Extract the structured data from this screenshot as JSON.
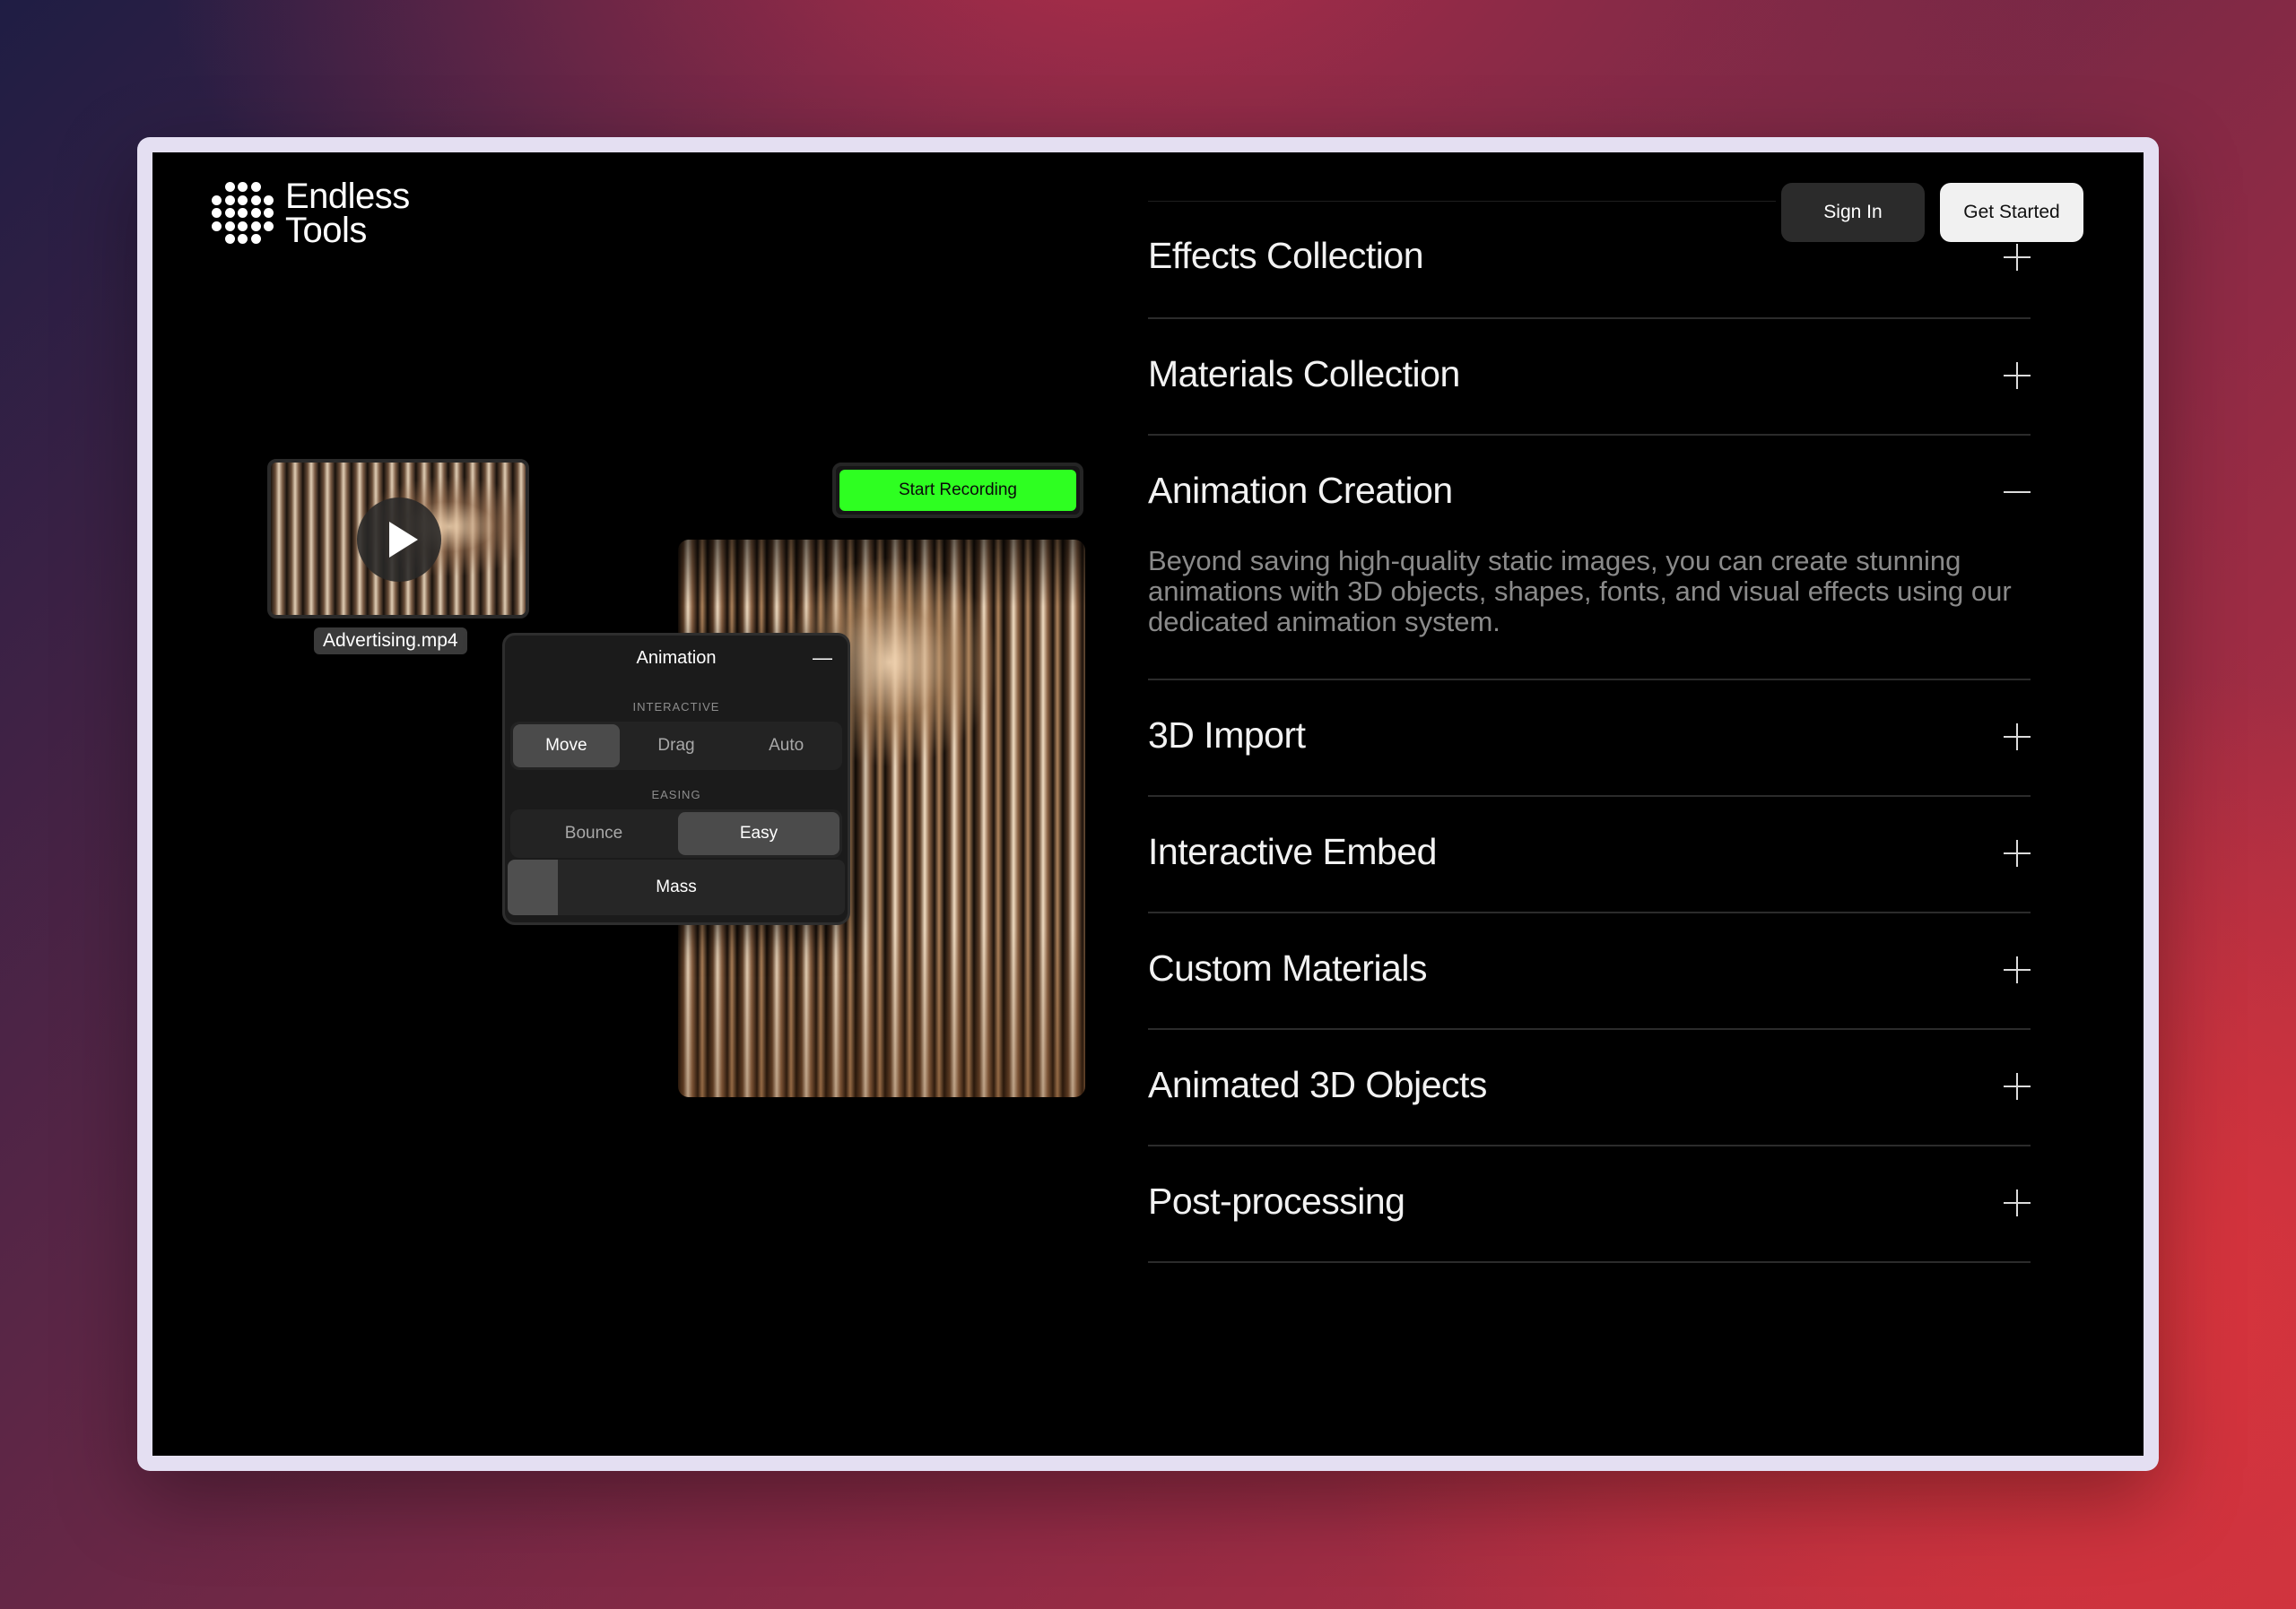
{
  "brand": {
    "name_line1": "Endless",
    "name_line2": "Tools"
  },
  "header": {
    "sign_in_label": "Sign In",
    "get_started_label": "Get Started"
  },
  "showcase": {
    "video_filename": "Advertising.mp4",
    "record_button_label": "Start Recording",
    "animation_panel": {
      "title": "Animation",
      "interactive_label": "INTERACTIVE",
      "interactive_options": [
        "Move",
        "Drag",
        "Auto"
      ],
      "interactive_selected": "Move",
      "easing_label": "EASING",
      "easing_options": [
        "Bounce",
        "Easy"
      ],
      "easing_selected": "Easy",
      "mass_label": "Mass",
      "mass_value_fraction": 0.15
    }
  },
  "features": [
    {
      "title": "Effects Collection",
      "expanded": false
    },
    {
      "title": "Materials Collection",
      "expanded": false
    },
    {
      "title": "Animation Creation",
      "expanded": true,
      "body": "Beyond saving high-quality static images, you can create stunning animations with 3D objects, shapes, fonts, and visual effects using our dedicated animation system."
    },
    {
      "title": "3D Import",
      "expanded": false
    },
    {
      "title": "Interactive Embed",
      "expanded": false
    },
    {
      "title": "Custom Materials",
      "expanded": false
    },
    {
      "title": "Animated 3D Objects",
      "expanded": false
    },
    {
      "title": "Post-processing",
      "expanded": false
    }
  ],
  "colors": {
    "record_button": "#2eff21",
    "screen_background": "#000000"
  }
}
